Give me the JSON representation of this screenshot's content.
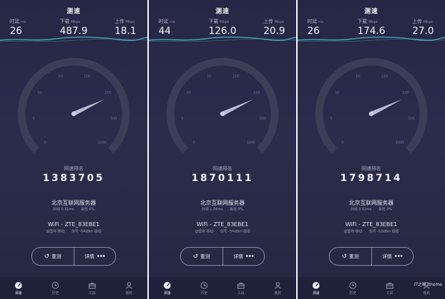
{
  "screens": [
    {
      "title": "测速",
      "ping": {
        "label": "时延",
        "unit": "ms",
        "value": "26"
      },
      "download": {
        "label": "下载",
        "unit": "Mbps",
        "value": "487.9"
      },
      "upload": {
        "label": "上传",
        "unit": "Mbps",
        "value": "18.1"
      },
      "gauge": {
        "ticks": [
          "0",
          "5",
          "10",
          "50",
          "100",
          "200",
          "500",
          "1000"
        ],
        "needle_fraction": 0.74
      },
      "rank": {
        "label": "网速排名",
        "value": "1383705"
      },
      "server": {
        "name": "北京互联网服务器",
        "jitter": "抖动 0.91ms",
        "loss": "丢包 0%"
      },
      "wifi": {
        "name": "WiFi - ZTE_83EBE1",
        "operator": "运营商 移动",
        "signal": "信号 -64dBm 极强"
      },
      "buttons": {
        "retest": "重测",
        "details": "详情"
      },
      "tabs": [
        {
          "label": "测速",
          "icon": "speedometer-icon"
        },
        {
          "label": "历史",
          "icon": "clock-icon"
        },
        {
          "label": "工具",
          "icon": "toolbox-icon"
        },
        {
          "label": "我的",
          "icon": "user-icon"
        }
      ]
    },
    {
      "title": "测速",
      "ping": {
        "label": "时延",
        "unit": "ms",
        "value": "44"
      },
      "download": {
        "label": "下载",
        "unit": "Mbps",
        "value": "126.0"
      },
      "upload": {
        "label": "上传",
        "unit": "Mbps",
        "value": "20.9"
      },
      "gauge": {
        "ticks": [
          "0",
          "5",
          "10",
          "50",
          "100",
          "200",
          "500",
          "1000"
        ],
        "needle_fraction": 0.74
      },
      "rank": {
        "label": "网速排名",
        "value": "1870111"
      },
      "server": {
        "name": "北京互联网服务器",
        "jitter": "抖动 1.54ms",
        "loss": "丢包 0%"
      },
      "wifi": {
        "name": "WiFi - ZTE_83EBE1",
        "operator": "运营商 移动",
        "signal": "信号 -54dBm 极强"
      },
      "buttons": {
        "retest": "重测",
        "details": "详情"
      },
      "tabs": [
        {
          "label": "测速",
          "icon": "speedometer-icon"
        },
        {
          "label": "历史",
          "icon": "clock-icon"
        },
        {
          "label": "工具",
          "icon": "toolbox-icon"
        },
        {
          "label": "我的",
          "icon": "user-icon"
        }
      ]
    },
    {
      "title": "测速",
      "ping": {
        "label": "时延",
        "unit": "ms",
        "value": "26"
      },
      "download": {
        "label": "下载",
        "unit": "Mbps",
        "value": "174.6"
      },
      "upload": {
        "label": "上传",
        "unit": "Mbps",
        "value": "27.0"
      },
      "gauge": {
        "ticks": [
          "0",
          "5",
          "10",
          "50",
          "100",
          "200",
          "500",
          "1000"
        ],
        "needle_fraction": 0.74
      },
      "rank": {
        "label": "网速排名",
        "value": "1798714"
      },
      "server": {
        "name": "北京互联网服务器",
        "jitter": "抖动 0.91ms",
        "loss": "丢包 0%"
      },
      "wifi": {
        "name": "WiFi - ZTE_83EBE1",
        "operator": "运营商 移动",
        "signal": "信号 -53dBm 极强"
      },
      "buttons": {
        "retest": "重测",
        "details": "详情"
      },
      "tabs": [
        {
          "label": "测速",
          "icon": "speedometer-icon"
        },
        {
          "label": "历史",
          "icon": "clock-icon"
        },
        {
          "label": "工具",
          "icon": "toolbox-icon"
        },
        {
          "label": "我的",
          "icon": "user-icon"
        }
      ]
    }
  ],
  "watermark": "IT之家 ithome",
  "colors": {
    "background": "#282a47",
    "tabbar": "#1f203a",
    "wave": "#4fb6c8",
    "gauge_track": "#3c3e58",
    "needle": "#c9cbe0"
  }
}
